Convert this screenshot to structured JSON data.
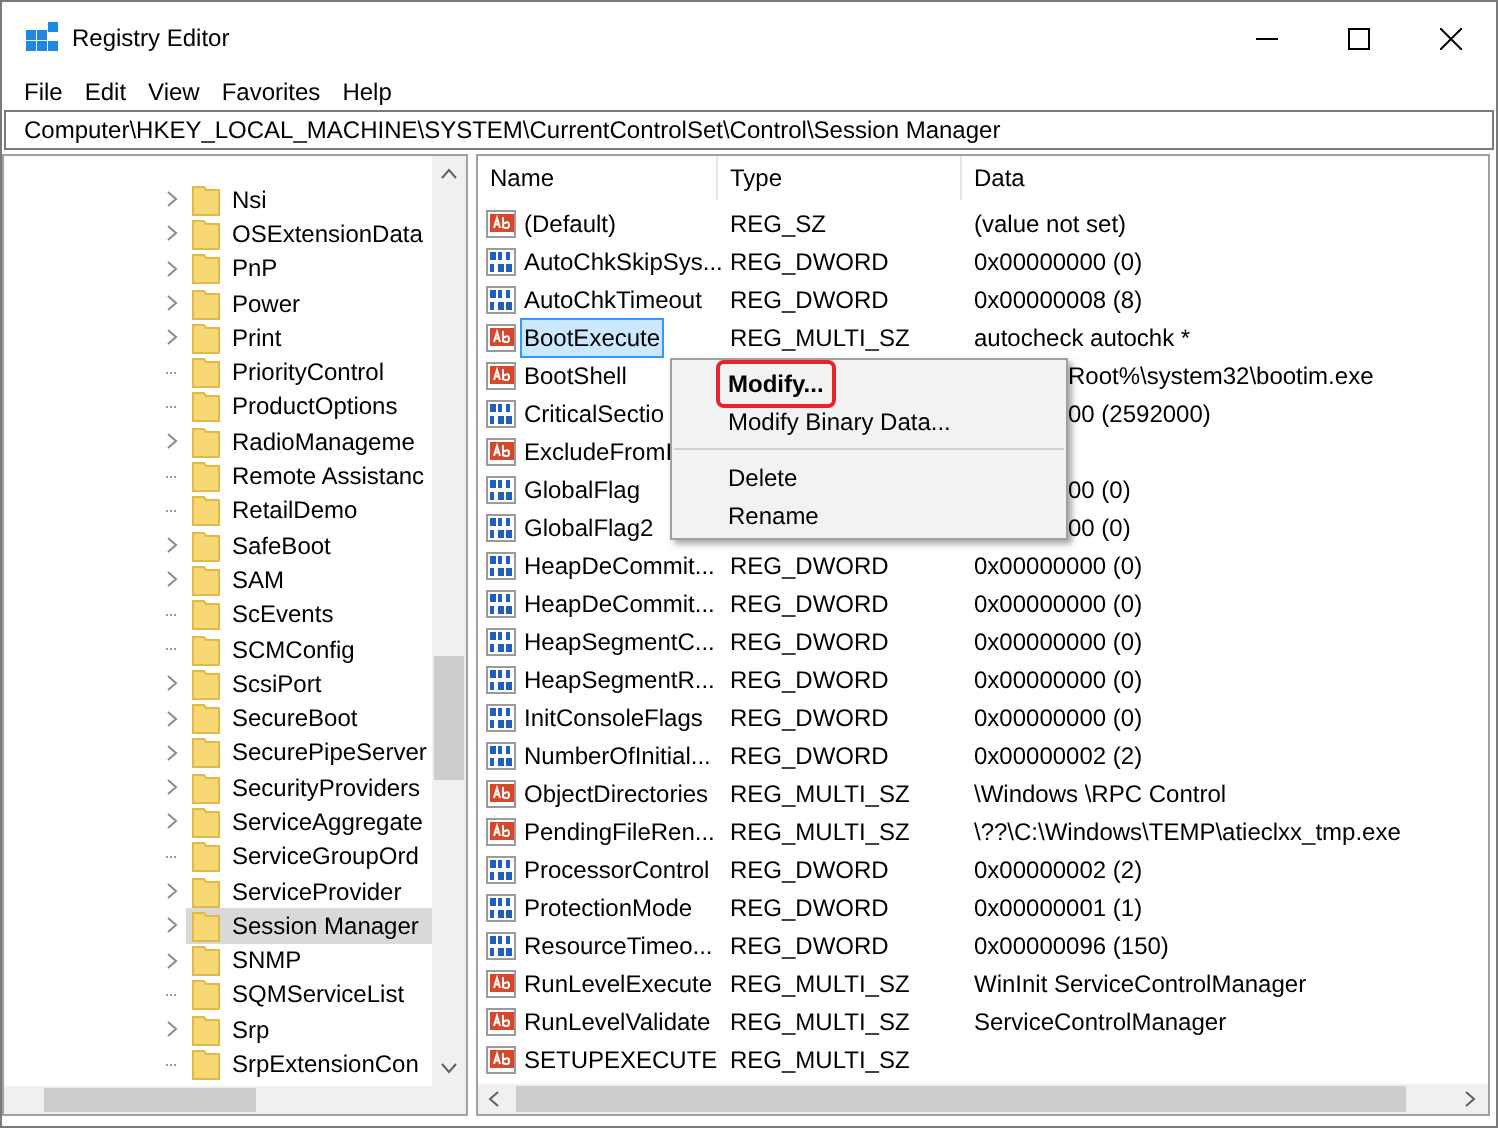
{
  "window": {
    "title": "Registry Editor"
  },
  "menu": [
    "File",
    "Edit",
    "View",
    "Favorites",
    "Help"
  ],
  "address": "Computer\\HKEY_LOCAL_MACHINE\\SYSTEM\\CurrentControlSet\\Control\\Session Manager",
  "tree": [
    {
      "label": "Nsi",
      "expandable": true,
      "selected": false
    },
    {
      "label": "OSExtensionData",
      "expandable": true,
      "selected": false
    },
    {
      "label": "PnP",
      "expandable": true,
      "selected": false
    },
    {
      "label": "Power",
      "expandable": true,
      "selected": false
    },
    {
      "label": "Print",
      "expandable": true,
      "selected": false
    },
    {
      "label": "PriorityControl",
      "expandable": false,
      "selected": false
    },
    {
      "label": "ProductOptions",
      "expandable": false,
      "selected": false
    },
    {
      "label": "RadioManageme",
      "expandable": true,
      "selected": false
    },
    {
      "label": "Remote Assistanc",
      "expandable": false,
      "selected": false
    },
    {
      "label": "RetailDemo",
      "expandable": false,
      "selected": false
    },
    {
      "label": "SafeBoot",
      "expandable": true,
      "selected": false
    },
    {
      "label": "SAM",
      "expandable": true,
      "selected": false
    },
    {
      "label": "ScEvents",
      "expandable": false,
      "selected": false
    },
    {
      "label": "SCMConfig",
      "expandable": false,
      "selected": false
    },
    {
      "label": "ScsiPort",
      "expandable": true,
      "selected": false
    },
    {
      "label": "SecureBoot",
      "expandable": true,
      "selected": false
    },
    {
      "label": "SecurePipeServer",
      "expandable": true,
      "selected": false
    },
    {
      "label": "SecurityProviders",
      "expandable": true,
      "selected": false
    },
    {
      "label": "ServiceAggregate",
      "expandable": true,
      "selected": false
    },
    {
      "label": "ServiceGroupOrd",
      "expandable": false,
      "selected": false
    },
    {
      "label": "ServiceProvider",
      "expandable": true,
      "selected": false
    },
    {
      "label": "Session Manager",
      "expandable": true,
      "selected": true
    },
    {
      "label": "SNMP",
      "expandable": true,
      "selected": false
    },
    {
      "label": "SQMServiceList",
      "expandable": false,
      "selected": false
    },
    {
      "label": "Srp",
      "expandable": true,
      "selected": false
    },
    {
      "label": "SrpExtensionCon",
      "expandable": false,
      "selected": false
    }
  ],
  "columns": [
    "Name",
    "Type",
    "Data"
  ],
  "rows": [
    {
      "kind": "string",
      "name": "(Default)",
      "type": "REG_SZ",
      "data": "(value not set)",
      "selected": false
    },
    {
      "kind": "binary",
      "name": "AutoChkSkipSys...",
      "type": "REG_DWORD",
      "data": "0x00000000 (0)",
      "selected": false
    },
    {
      "kind": "binary",
      "name": "AutoChkTimeout",
      "type": "REG_DWORD",
      "data": "0x00000008 (8)",
      "selected": false
    },
    {
      "kind": "string",
      "name": "BootExecute",
      "type": "REG_MULTI_SZ",
      "data": "autocheck autochk *",
      "selected": true
    },
    {
      "kind": "string",
      "name": "BootShell",
      "data": "Root%\\system32\\bootim.exe",
      "selected": false,
      "under_menu": true
    },
    {
      "kind": "binary",
      "name": "CriticalSectio",
      "data": "00 (2592000)",
      "selected": false,
      "under_menu": true
    },
    {
      "kind": "string",
      "name": "ExcludeFromI",
      "selected": false
    },
    {
      "kind": "binary",
      "name": "GlobalFlag",
      "data": "00 (0)",
      "selected": false,
      "under_menu": true
    },
    {
      "kind": "binary",
      "name": "GlobalFlag2",
      "data": "00 (0)",
      "selected": false,
      "under_menu": true
    },
    {
      "kind": "binary",
      "name": "HeapDeCommit...",
      "type": "REG_DWORD",
      "data": "0x00000000 (0)",
      "selected": false
    },
    {
      "kind": "binary",
      "name": "HeapDeCommit...",
      "type": "REG_DWORD",
      "data": "0x00000000 (0)",
      "selected": false
    },
    {
      "kind": "binary",
      "name": "HeapSegmentC...",
      "type": "REG_DWORD",
      "data": "0x00000000 (0)",
      "selected": false
    },
    {
      "kind": "binary",
      "name": "HeapSegmentR...",
      "type": "REG_DWORD",
      "data": "0x00000000 (0)",
      "selected": false
    },
    {
      "kind": "binary",
      "name": "InitConsoleFlags",
      "type": "REG_DWORD",
      "data": "0x00000000 (0)",
      "selected": false
    },
    {
      "kind": "binary",
      "name": "NumberOfInitial...",
      "type": "REG_DWORD",
      "data": "0x00000002 (2)",
      "selected": false
    },
    {
      "kind": "string",
      "name": "ObjectDirectories",
      "type": "REG_MULTI_SZ",
      "data": "\\Windows \\RPC Control",
      "selected": false
    },
    {
      "kind": "string",
      "name": "PendingFileRen...",
      "type": "REG_MULTI_SZ",
      "data": "\\??\\C:\\Windows\\TEMP\\atieclxx_tmp.exe",
      "selected": false
    },
    {
      "kind": "binary",
      "name": "ProcessorControl",
      "type": "REG_DWORD",
      "data": "0x00000002 (2)",
      "selected": false
    },
    {
      "kind": "binary",
      "name": "ProtectionMode",
      "type": "REG_DWORD",
      "data": "0x00000001 (1)",
      "selected": false
    },
    {
      "kind": "binary",
      "name": "ResourceTimeo...",
      "type": "REG_DWORD",
      "data": "0x00000096 (150)",
      "selected": false
    },
    {
      "kind": "string",
      "name": "RunLevelExecute",
      "type": "REG_MULTI_SZ",
      "data": "WinInit ServiceControlManager",
      "selected": false
    },
    {
      "kind": "string",
      "name": "RunLevelValidate",
      "type": "REG_MULTI_SZ",
      "data": "ServiceControlManager",
      "selected": false
    },
    {
      "kind": "string",
      "name": "SETUPEXECUTE",
      "type": "REG_MULTI_SZ",
      "selected": false
    }
  ],
  "context_menu": [
    {
      "kind": "item",
      "label": "Modify...",
      "bold": true,
      "highlighted": true
    },
    {
      "kind": "item",
      "label": "Modify Binary Data...",
      "bold": false,
      "highlighted": false
    },
    {
      "kind": "separator"
    },
    {
      "kind": "item",
      "label": "Delete",
      "bold": false,
      "highlighted": false
    },
    {
      "kind": "item",
      "label": "Rename",
      "bold": false,
      "highlighted": false
    }
  ]
}
